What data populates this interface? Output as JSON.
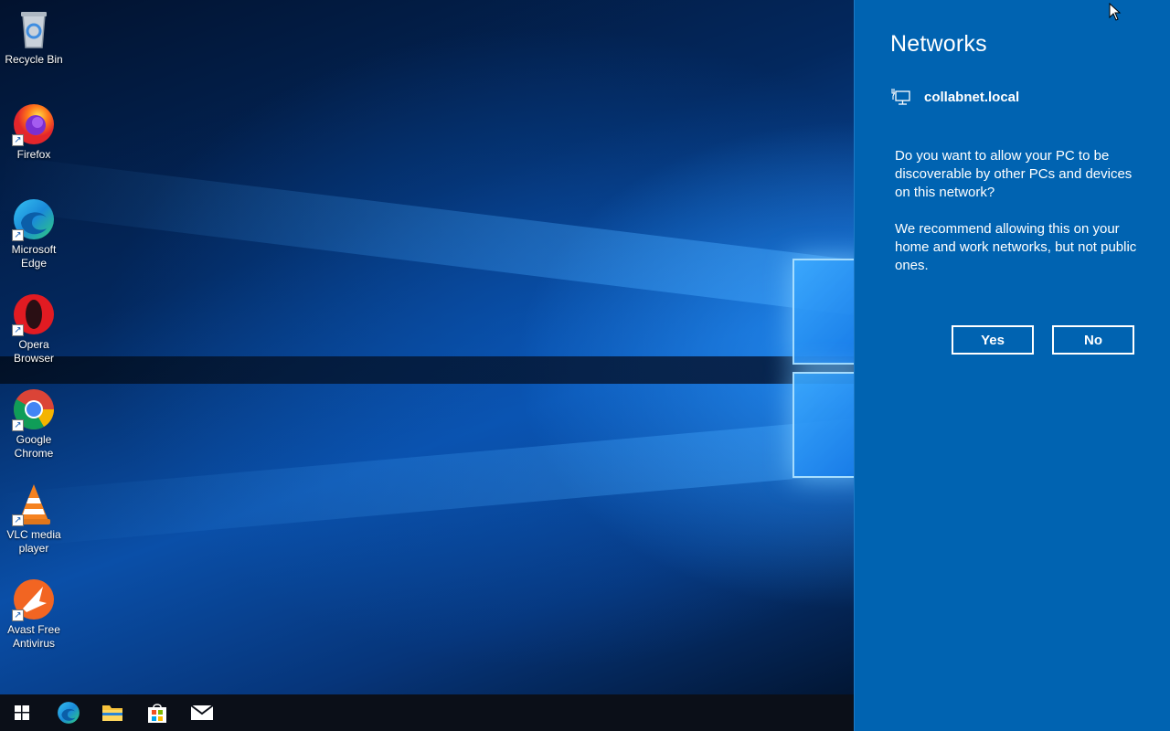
{
  "desktop": {
    "icons": [
      {
        "label": "Recycle Bin",
        "icon": "recycle-bin-icon"
      },
      {
        "label": "Firefox",
        "icon": "firefox-icon"
      },
      {
        "label": "Microsoft Edge",
        "icon": "edge-icon"
      },
      {
        "label": "Opera Browser",
        "icon": "opera-icon"
      },
      {
        "label": "Google Chrome",
        "icon": "chrome-icon"
      },
      {
        "label": "VLC media player",
        "icon": "vlc-icon"
      },
      {
        "label": "Avast Free Antivirus",
        "icon": "avast-icon"
      }
    ]
  },
  "taskbar": {
    "items": [
      "windows-start-icon",
      "edge-icon",
      "file-explorer-icon",
      "microsoft-store-icon",
      "mail-icon"
    ]
  },
  "flyout": {
    "title": "Networks",
    "network_name": "collabnet.local",
    "network_icon": "ethernet-icon",
    "question": "Do you want to allow your PC to be discoverable by other PCs and devices on this network?",
    "recommendation": "We recommend allowing this on your home and work networks, but not public ones.",
    "yes_label": "Yes",
    "no_label": "No",
    "background_color": "#0063b1"
  }
}
